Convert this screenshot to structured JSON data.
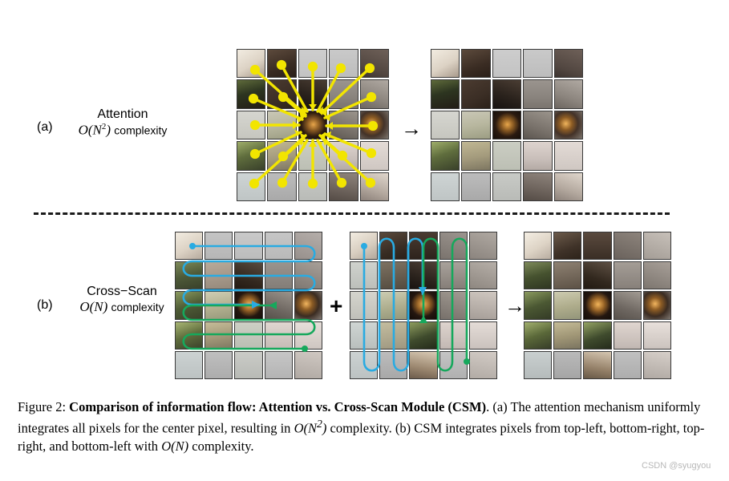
{
  "figure": {
    "rows": [
      {
        "tag": "(a)",
        "method": "Attention",
        "complexity_symbol": "O",
        "complexity_arg": "N",
        "complexity_exp": "2",
        "complexity_word": "complexity",
        "operator_between_panels": "→"
      },
      {
        "tag": "(b)",
        "method": "Cross−Scan",
        "complexity_symbol": "O",
        "complexity_arg": "N",
        "complexity_exp": "",
        "complexity_word": "complexity",
        "operator_plus": "+",
        "operator_arrow": "→"
      }
    ],
    "colors": {
      "attention_arrow": "#F2E500",
      "scan_forward": "#29ABE2",
      "scan_backward": "#16A85C",
      "patch_border": "#3a3a3a",
      "divider": "#1a1a1a",
      "text": "#000000",
      "watermark": "#b8b8b8"
    },
    "grid": {
      "rows": 5,
      "cols": 5,
      "label": "5x5 image patch grid"
    },
    "panels": [
      {
        "name": "attention-input-grid",
        "row": "a"
      },
      {
        "name": "attention-output-grid",
        "row": "a"
      },
      {
        "name": "crossscan-horizontal-grid",
        "row": "b"
      },
      {
        "name": "crossscan-vertical-grid",
        "row": "b"
      },
      {
        "name": "crossscan-output-grid",
        "row": "b"
      }
    ]
  },
  "caption": {
    "label": "Figure 2:",
    "title": "Comparison of information flow: Attention vs.  Cross-Scan Module (CSM)",
    "line_a_pre": ". (a) The attention mechanism uniformly integrates all pixels for the center pixel, resulting in ",
    "big_o_1": "O",
    "big_o_1_arg": "N",
    "big_o_1_exp": "2",
    "line_b_pre": " complexity. (b) CSM integrates pixels from top-left, bottom-right, top-right, and bottom-left with ",
    "big_o_2": "O",
    "big_o_2_arg": "N",
    "line_b_post": " complexity."
  },
  "watermark": {
    "text": "CSDN @syugyou"
  }
}
